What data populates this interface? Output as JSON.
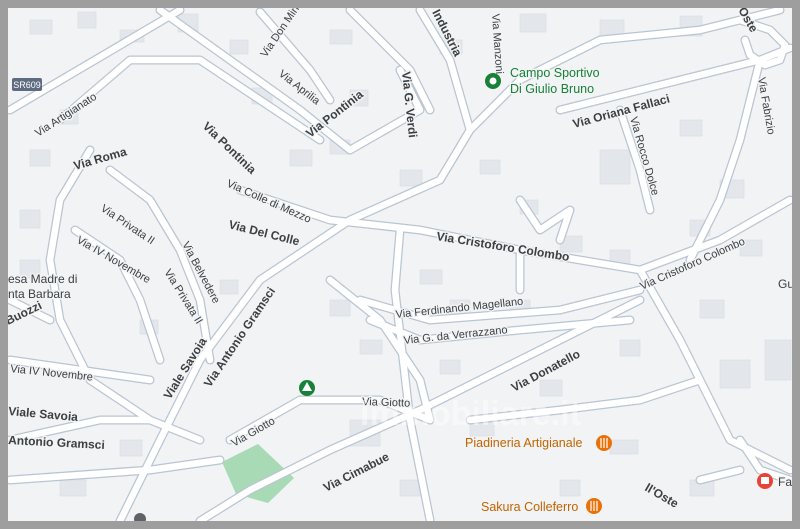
{
  "route_shield": "SR609",
  "watermark": "immobiliare.it",
  "colors": {
    "background": "#f1f3f4",
    "road_casing": "#b9c5d3",
    "road_fill": "#ffffff",
    "poi_green": "#188038",
    "poi_orange": "#c26401",
    "park": "#a8dab5"
  },
  "streets": {
    "via_artigianato": "Via Artigianato",
    "via_roma": "Via Roma",
    "via_pontinia_a": "Via Pontinia",
    "via_pontinia_b": "Via Pontinia",
    "via_don_minzoni": "Via Don Minzo",
    "via_aprilia": "Via Aprilia",
    "via_g_verdi": "Via G. Verdi",
    "via_industria": "Industria",
    "via_manzoni": "Via Manzoni",
    "via_oriana_fallaci": "Via Oriana Fallaci",
    "via_rocco_dolce": "Via Rocco Dolce",
    "via_fabrizio": "Via Fabrizio",
    "via_oste_top": "Oste",
    "via_colle_di_mezzo": "Via Colle di Mezzo",
    "via_del_colle": "Via Del Colle",
    "via_cristoforo_colombo_a": "Via Cristoforo Colombo",
    "via_cristoforo_colombo_b": "Via Cristoforo Colombo",
    "via_privata_1": "Via Privata II",
    "via_iv_novembre_a": "Via IV Novembre",
    "via_belvedere": "Via Belvedere",
    "via_privata_2": "Via Privata II",
    "via_antonio_gramsci_a": "Via Antonio Gramsci",
    "via_ferdinando_magellano": "Via Ferdinando Magellano",
    "via_g_da_verrazzano": "Via G. da Verrazzano",
    "viale_savoia_a": "Viale Savoia",
    "via_iv_novembre_b": "Via IV Novembre",
    "viale_savoia_b": "Viale Savoia",
    "antonio_gramsci_b": "Antonio Gramsci",
    "buozzi": "Buozzi",
    "via_donatello": "Via Donatello",
    "via_giotto_a": "Via Giotto",
    "via_giotto_b": "Via Giotto",
    "via_cimabue": "Via Cimabue",
    "via_oste_bottom": "ll'Oste"
  },
  "labels": {
    "chiesa_line1": "esa Madre di",
    "chiesa_line2": "nta Barbara",
    "gu_partial": "Gu",
    "fa_partial": "Fa"
  },
  "pois": {
    "campo_line1": "Campo Sportivo",
    "campo_line2": "Di Giulio Bruno",
    "piadineria": "Piadineria Artigianale",
    "sakura": "Sakura Colleferro"
  }
}
